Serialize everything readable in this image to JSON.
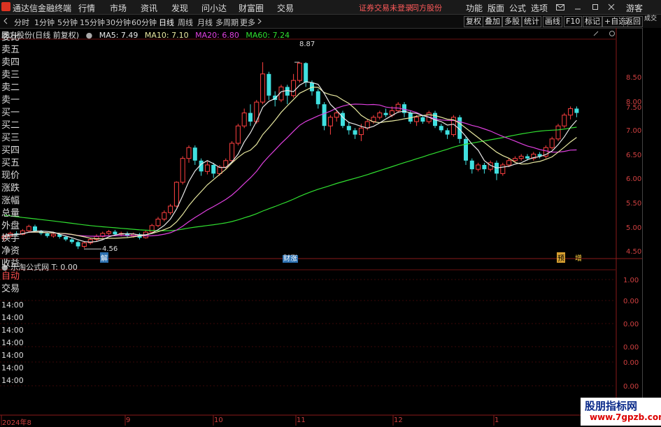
{
  "app": {
    "title": "通达信金融终端"
  },
  "menu": [
    "行情",
    "市场",
    "资讯",
    "发现",
    "问小达",
    "财富圈",
    "交易"
  ],
  "status": {
    "warning": "证券交易未登录",
    "stock": "同方股份"
  },
  "right_menu": [
    "功能",
    "版面",
    "公式",
    "选项"
  ],
  "guest": "游客",
  "periods": [
    "分时",
    "1分钟",
    "5分钟",
    "15分钟",
    "30分钟",
    "60分钟",
    "日线",
    "周线",
    "月线",
    "多周期",
    "更多"
  ],
  "active_period": "日线",
  "toolbar_buttons": [
    "复权",
    "叠加",
    "多股",
    "统计",
    "画线",
    "F10",
    "标记",
    "+自选",
    "返回"
  ],
  "chart_header": {
    "name": "同方股份(日线 前复权)",
    "ma5": "MA5: 7.49",
    "ma10": "MA10: 7.10",
    "ma20": "MA20: 6.80",
    "ma60": "MA60: 7.24"
  },
  "sub_header": {
    "name": "乐淘公式网",
    "value": "T: 0.00"
  },
  "price_axis": [
    "8.50",
    "8.00",
    "7.50",
    "7.00",
    "6.50",
    "6.00",
    "5.50",
    "5.00",
    "4.50"
  ],
  "sub_axis": [
    "1.00",
    "0.00",
    "0.00",
    "0.00",
    "0.00",
    "0.00"
  ],
  "annotations": {
    "high": "8.87",
    "low": "4.56",
    "jie": "解",
    "caizhang": "财涨",
    "yu": "预",
    "zeng": "增"
  },
  "side_items": [
    "委比",
    "卖五",
    "卖四",
    "卖三",
    "卖二",
    "卖一",
    "买一",
    "买二",
    "买三",
    "买四",
    "买五",
    "现价",
    "涨跌",
    "涨幅",
    "总量",
    "外盘",
    "换手",
    "净资",
    "收益"
  ],
  "side_top": "成交",
  "side_bottom": [
    "自动",
    "交易"
  ],
  "side_times": [
    "14:00",
    "14:00",
    "14:00",
    "14:00",
    "14:00",
    "14:00",
    "14:00"
  ],
  "timeline": [
    "2024年8",
    "9",
    "10",
    "11",
    "12",
    "1"
  ],
  "watermark": {
    "main": "股朋指标网",
    "url": "www.7gpzb.com"
  },
  "colors": {
    "up": "#ff4040",
    "down": "#40e0e0",
    "ma5": "#e8e8e8",
    "ma10": "#e8e8a0",
    "ma20": "#e040e0",
    "ma60": "#30e030",
    "axis": "#d04040"
  },
  "candles": [
    {
      "o": 4.8,
      "c": 4.85,
      "h": 4.9,
      "l": 4.75
    },
    {
      "o": 4.85,
      "c": 4.92,
      "h": 4.96,
      "l": 4.82
    },
    {
      "o": 4.92,
      "c": 4.9,
      "h": 4.97,
      "l": 4.85
    },
    {
      "o": 4.9,
      "c": 4.98,
      "h": 5.02,
      "l": 4.88
    },
    {
      "o": 4.98,
      "c": 5.08,
      "h": 5.12,
      "l": 4.95
    },
    {
      "o": 5.08,
      "c": 4.98,
      "h": 5.12,
      "l": 4.95
    },
    {
      "o": 4.98,
      "c": 4.92,
      "h": 5.0,
      "l": 4.88
    },
    {
      "o": 4.92,
      "c": 4.86,
      "h": 4.95,
      "l": 4.82
    },
    {
      "o": 4.86,
      "c": 4.9,
      "h": 4.94,
      "l": 4.82
    },
    {
      "o": 4.9,
      "c": 4.84,
      "h": 4.93,
      "l": 4.8
    },
    {
      "o": 4.84,
      "c": 4.78,
      "h": 4.87,
      "l": 4.74
    },
    {
      "o": 4.78,
      "c": 4.72,
      "h": 4.82,
      "l": 4.68
    },
    {
      "o": 4.72,
      "c": 4.62,
      "h": 4.75,
      "l": 4.56
    },
    {
      "o": 4.62,
      "c": 4.7,
      "h": 4.74,
      "l": 4.58
    },
    {
      "o": 4.7,
      "c": 4.78,
      "h": 4.82,
      "l": 4.66
    },
    {
      "o": 4.78,
      "c": 4.85,
      "h": 4.9,
      "l": 4.74
    },
    {
      "o": 4.85,
      "c": 4.92,
      "h": 4.96,
      "l": 4.82
    },
    {
      "o": 4.92,
      "c": 4.96,
      "h": 5.0,
      "l": 4.88
    },
    {
      "o": 4.96,
      "c": 4.9,
      "h": 5.0,
      "l": 4.86
    },
    {
      "o": 4.9,
      "c": 4.92,
      "h": 4.96,
      "l": 4.85
    },
    {
      "o": 4.92,
      "c": 4.86,
      "h": 4.96,
      "l": 4.82
    },
    {
      "o": 4.86,
      "c": 4.9,
      "h": 4.94,
      "l": 4.82
    },
    {
      "o": 4.9,
      "c": 4.82,
      "h": 4.93,
      "l": 4.78
    },
    {
      "o": 4.82,
      "c": 4.95,
      "h": 4.98,
      "l": 4.8
    },
    {
      "o": 4.95,
      "c": 5.1,
      "h": 5.14,
      "l": 4.92
    },
    {
      "o": 5.1,
      "c": 5.25,
      "h": 5.3,
      "l": 5.06
    },
    {
      "o": 5.25,
      "c": 5.4,
      "h": 5.45,
      "l": 5.2
    },
    {
      "o": 5.4,
      "c": 5.55,
      "h": 5.6,
      "l": 5.35
    },
    {
      "o": 5.55,
      "c": 6.1,
      "h": 6.12,
      "l": 5.52
    },
    {
      "o": 6.1,
      "c": 6.65,
      "h": 6.7,
      "l": 6.05
    },
    {
      "o": 6.65,
      "c": 6.9,
      "h": 6.95,
      "l": 6.55
    },
    {
      "o": 6.9,
      "c": 6.6,
      "h": 6.95,
      "l": 6.5
    },
    {
      "o": 6.6,
      "c": 6.35,
      "h": 6.65,
      "l": 6.25
    },
    {
      "o": 6.35,
      "c": 6.5,
      "h": 6.58,
      "l": 6.28
    },
    {
      "o": 6.5,
      "c": 6.3,
      "h": 6.55,
      "l": 6.2
    },
    {
      "o": 6.3,
      "c": 6.45,
      "h": 6.5,
      "l": 6.25
    },
    {
      "o": 6.45,
      "c": 6.6,
      "h": 6.65,
      "l": 6.4
    },
    {
      "o": 6.6,
      "c": 7.0,
      "h": 7.05,
      "l": 6.55
    },
    {
      "o": 7.0,
      "c": 7.4,
      "h": 7.45,
      "l": 6.95
    },
    {
      "o": 7.4,
      "c": 7.7,
      "h": 7.8,
      "l": 7.35
    },
    {
      "o": 7.7,
      "c": 7.5,
      "h": 7.9,
      "l": 7.4
    },
    {
      "o": 7.5,
      "c": 7.95,
      "h": 8.0,
      "l": 7.45
    },
    {
      "o": 7.95,
      "c": 8.6,
      "h": 8.87,
      "l": 7.9
    },
    {
      "o": 8.6,
      "c": 8.1,
      "h": 8.65,
      "l": 8.0
    },
    {
      "o": 8.1,
      "c": 8.0,
      "h": 8.2,
      "l": 7.85
    },
    {
      "o": 8.0,
      "c": 8.3,
      "h": 8.35,
      "l": 7.95
    },
    {
      "o": 8.3,
      "c": 8.1,
      "h": 8.35,
      "l": 7.9
    },
    {
      "o": 8.1,
      "c": 8.45,
      "h": 8.6,
      "l": 8.05
    },
    {
      "o": 8.45,
      "c": 8.85,
      "h": 8.87,
      "l": 8.4
    },
    {
      "o": 8.85,
      "c": 8.4,
      "h": 8.87,
      "l": 8.3
    },
    {
      "o": 8.4,
      "c": 8.2,
      "h": 8.45,
      "l": 8.1
    },
    {
      "o": 8.2,
      "c": 7.9,
      "h": 8.25,
      "l": 7.8
    },
    {
      "o": 7.9,
      "c": 7.4,
      "h": 7.95,
      "l": 7.3
    },
    {
      "o": 7.4,
      "c": 7.6,
      "h": 7.65,
      "l": 7.2
    },
    {
      "o": 7.6,
      "c": 7.7,
      "h": 7.75,
      "l": 7.5
    },
    {
      "o": 7.7,
      "c": 7.4,
      "h": 7.75,
      "l": 7.35
    },
    {
      "o": 7.4,
      "c": 7.3,
      "h": 7.5,
      "l": 7.2
    },
    {
      "o": 7.3,
      "c": 7.2,
      "h": 7.35,
      "l": 7.1
    },
    {
      "o": 7.2,
      "c": 7.35,
      "h": 7.45,
      "l": 7.05
    },
    {
      "o": 7.35,
      "c": 7.5,
      "h": 7.55,
      "l": 7.3
    },
    {
      "o": 7.5,
      "c": 7.6,
      "h": 7.65,
      "l": 7.45
    },
    {
      "o": 7.6,
      "c": 7.7,
      "h": 7.75,
      "l": 7.55
    },
    {
      "o": 7.7,
      "c": 7.65,
      "h": 7.8,
      "l": 7.6
    },
    {
      "o": 7.65,
      "c": 7.75,
      "h": 7.85,
      "l": 7.6
    },
    {
      "o": 7.75,
      "c": 7.9,
      "h": 7.95,
      "l": 7.7
    },
    {
      "o": 7.9,
      "c": 7.7,
      "h": 7.95,
      "l": 7.6
    },
    {
      "o": 7.7,
      "c": 7.5,
      "h": 7.75,
      "l": 7.45
    },
    {
      "o": 7.5,
      "c": 7.6,
      "h": 7.65,
      "l": 7.4
    },
    {
      "o": 7.6,
      "c": 7.5,
      "h": 7.65,
      "l": 7.45
    },
    {
      "o": 7.5,
      "c": 7.7,
      "h": 7.75,
      "l": 7.45
    },
    {
      "o": 7.7,
      "c": 7.4,
      "h": 7.75,
      "l": 7.35
    },
    {
      "o": 7.4,
      "c": 7.3,
      "h": 7.45,
      "l": 7.25
    },
    {
      "o": 7.3,
      "c": 7.2,
      "h": 7.35,
      "l": 7.1
    },
    {
      "o": 7.2,
      "c": 7.6,
      "h": 7.65,
      "l": 7.15
    },
    {
      "o": 7.6,
      "c": 7.1,
      "h": 7.65,
      "l": 7.0
    },
    {
      "o": 7.1,
      "c": 6.6,
      "h": 7.15,
      "l": 6.5
    },
    {
      "o": 6.6,
      "c": 6.4,
      "h": 6.65,
      "l": 6.3
    },
    {
      "o": 6.4,
      "c": 6.5,
      "h": 6.55,
      "l": 6.35
    },
    {
      "o": 6.5,
      "c": 6.4,
      "h": 6.55,
      "l": 6.3
    },
    {
      "o": 6.4,
      "c": 6.55,
      "h": 6.6,
      "l": 6.35
    },
    {
      "o": 6.55,
      "c": 6.3,
      "h": 6.6,
      "l": 6.15
    },
    {
      "o": 6.3,
      "c": 6.5,
      "h": 6.55,
      "l": 6.25
    },
    {
      "o": 6.5,
      "c": 6.6,
      "h": 6.65,
      "l": 6.45
    },
    {
      "o": 6.6,
      "c": 6.65,
      "h": 6.7,
      "l": 6.55
    },
    {
      "o": 6.65,
      "c": 6.7,
      "h": 6.75,
      "l": 6.6
    },
    {
      "o": 6.7,
      "c": 6.65,
      "h": 6.75,
      "l": 6.6
    },
    {
      "o": 6.65,
      "c": 6.75,
      "h": 6.8,
      "l": 6.6
    },
    {
      "o": 6.75,
      "c": 6.7,
      "h": 6.8,
      "l": 6.65
    },
    {
      "o": 6.7,
      "c": 6.9,
      "h": 6.95,
      "l": 6.65
    },
    {
      "o": 6.9,
      "c": 7.1,
      "h": 7.15,
      "l": 6.85
    },
    {
      "o": 7.1,
      "c": 7.4,
      "h": 7.45,
      "l": 7.05
    },
    {
      "o": 7.4,
      "c": 7.65,
      "h": 7.7,
      "l": 7.35
    },
    {
      "o": 7.65,
      "c": 7.8,
      "h": 7.85,
      "l": 7.55
    },
    {
      "o": 7.8,
      "c": 7.7,
      "h": 7.85,
      "l": 7.6
    }
  ]
}
